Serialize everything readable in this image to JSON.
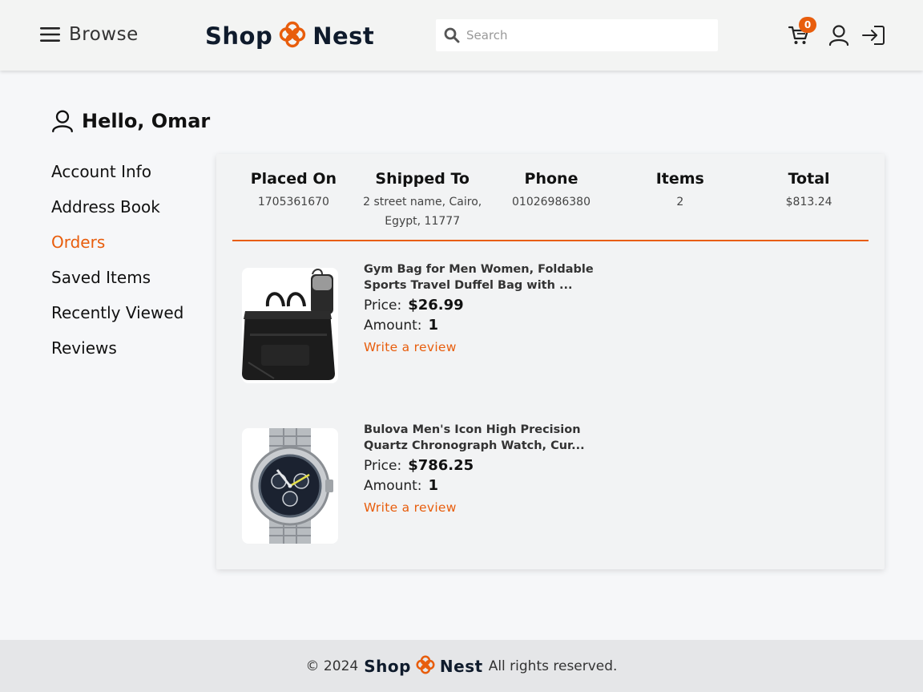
{
  "header": {
    "browse_label": "Browse",
    "logo": {
      "left": "Shop",
      "right": "Nest"
    },
    "search_placeholder": "Search",
    "cart_count": "0"
  },
  "account": {
    "greeting": "Hello, Omar",
    "nav": [
      {
        "label": "Account Info",
        "active": false
      },
      {
        "label": "Address Book",
        "active": false
      },
      {
        "label": "Orders",
        "active": true
      },
      {
        "label": "Saved Items",
        "active": false
      },
      {
        "label": "Recently Viewed",
        "active": false
      },
      {
        "label": "Reviews",
        "active": false
      }
    ]
  },
  "order": {
    "headers": [
      "Placed On",
      "Shipped To",
      "Phone",
      "Items",
      "Total"
    ],
    "values": [
      "1705361670",
      "2 street name, Cairo, Egypt, 11777",
      "01026986380",
      "2",
      "$813.24"
    ],
    "items": [
      {
        "title": "Gym Bag for Men Women, Foldable Sports Travel Duffel Bag with ...",
        "price_label": "Price:",
        "price": "$26.99",
        "amount_label": "Amount:",
        "amount": "1",
        "review_label": "Write a review",
        "image_icon": "duffel-bag-image"
      },
      {
        "title": "Bulova Men's Icon High Precision Quartz Chronograph Watch, Cur...",
        "price_label": "Price:",
        "price": "$786.25",
        "amount_label": "Amount:",
        "amount": "1",
        "review_label": "Write a review",
        "image_icon": "wristwatch-image"
      }
    ]
  },
  "footer": {
    "copyright": "© 2024",
    "logo": {
      "left": "Shop",
      "right": "Nest"
    },
    "rights": "All rights reserved."
  },
  "colors": {
    "accent": "#e85d0c",
    "logo_text": "#0f1b2c",
    "header_bg": "#f3f4f3",
    "footer_bg": "#e5e6e8"
  }
}
